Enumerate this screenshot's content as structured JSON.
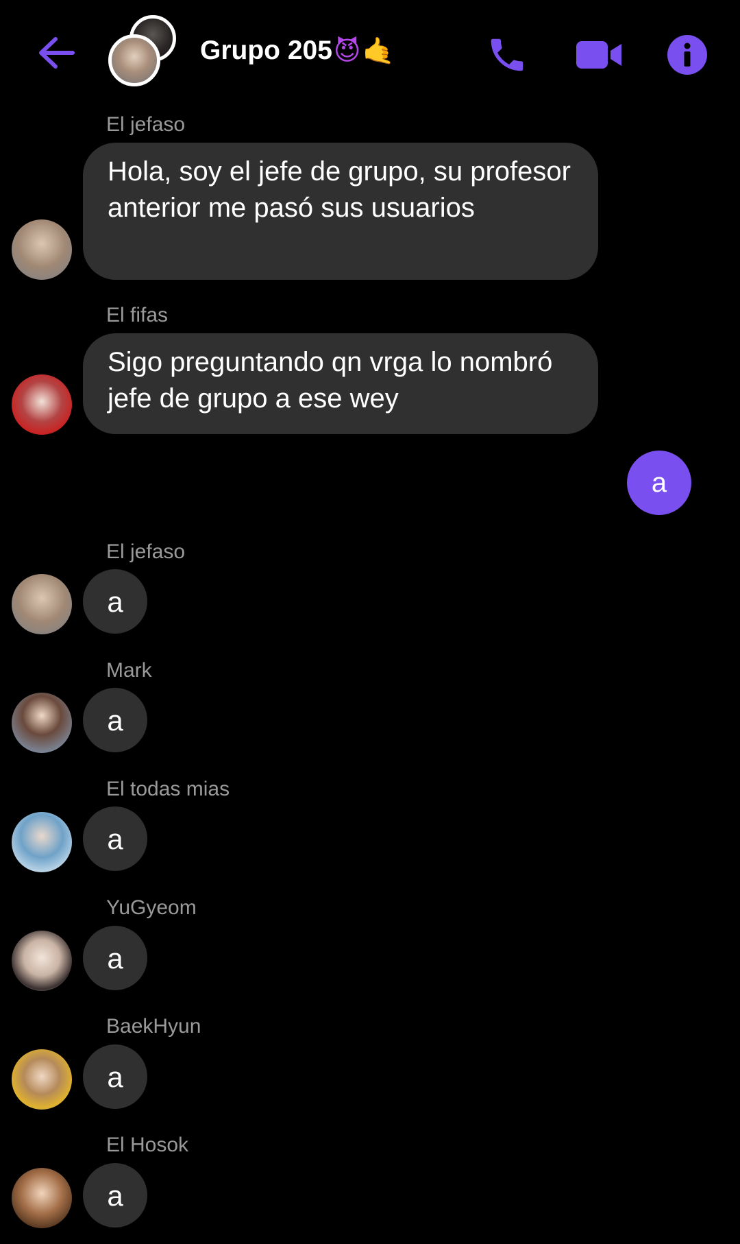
{
  "header": {
    "title": "Grupo 205",
    "emoji_devil": "😈",
    "emoji_hand": "🤙",
    "back_icon": "arrow-left-icon",
    "call_icon": "phone-icon",
    "video_icon": "video-camera-icon",
    "info_icon": "info-icon",
    "accent_color": "#7a4ff0"
  },
  "messages": [
    {
      "sender": "El jefaso",
      "text": "Hola, soy el jefe de grupo, su profesor anterior me pasó sus usuarios"
    },
    {
      "sender": "El fifas",
      "text": "Sigo preguntando qn vrga lo nombró jefe de grupo a ese wey"
    },
    {
      "outgoing": true,
      "text": "a"
    },
    {
      "sender": "El jefaso",
      "text": "a"
    },
    {
      "sender": "Mark",
      "text": "a"
    },
    {
      "sender": "El todas mias",
      "text": "a"
    },
    {
      "sender": "YuGyeom",
      "text": "a"
    },
    {
      "sender": "BaekHyun",
      "text": "a"
    },
    {
      "sender": "El Hosok",
      "text": "a"
    }
  ],
  "colors": {
    "background": "#000000",
    "bubble_incoming": "#303030",
    "bubble_outgoing": "#7a4ff0",
    "sender_name": "#9a9a9a"
  }
}
